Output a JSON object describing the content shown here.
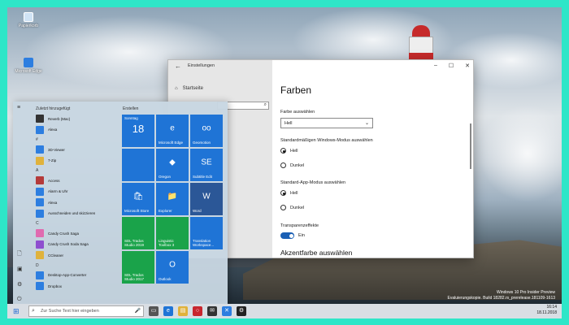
{
  "colors": {
    "accent": "#1a5fb4",
    "teal_frame": "#2ee6c8",
    "tile_blue": "#1f74d6",
    "tile_green": "#1aa34a",
    "tile_red": "#c8262e"
  },
  "desktop": {
    "icons": [
      {
        "label": "Papierkorb",
        "icon": "recycle-bin-icon"
      },
      {
        "label": "Microsoft Edge",
        "icon": "monitor-icon"
      }
    ]
  },
  "settings": {
    "title": "Einstellungen",
    "home": "Startseite",
    "page_title": "Farben",
    "color_label": "Farbe auswählen",
    "color_value": "Hell",
    "windows_mode_label": "Standardmäßigen Windows-Modus auswählen",
    "windows_mode_options": [
      {
        "label": "Hell",
        "selected": true
      },
      {
        "label": "Dunkel",
        "selected": false
      }
    ],
    "app_mode_label": "Standard-App-Modus auswählen",
    "app_mode_options": [
      {
        "label": "Hell",
        "selected": true
      },
      {
        "label": "Dunkel",
        "selected": false
      }
    ],
    "transparency_label": "Transparenzeffekte",
    "transparency_value": "Ein",
    "accent_heading": "Akzentfarbe auswählen"
  },
  "start": {
    "recent_heading": "Zuletzt hinzugefügt",
    "tiles_heading": "Erstellen",
    "apps": [
      {
        "label": "Reverb (Mac)",
        "color": "#333"
      },
      {
        "label": "Alexa",
        "color": "#2d7ee0"
      },
      {
        "letter": "#"
      },
      {
        "label": "3D-Viewer",
        "color": "#2d7ee0"
      },
      {
        "label": "7-Zip",
        "color": "#e0b23c"
      },
      {
        "letter": "A"
      },
      {
        "label": "Access",
        "color": "#b43a3a"
      },
      {
        "label": "Alarm & Uhr",
        "color": "#2d7ee0"
      },
      {
        "label": "Alexa",
        "color": "#2d7ee0"
      },
      {
        "label": "Ausschneiden und skizzieren",
        "color": "#2d7ee0"
      },
      {
        "letter": "C"
      },
      {
        "label": "Candy Crush Saga",
        "color": "#e06bb0"
      },
      {
        "label": "Candy Crush Soda Saga",
        "color": "#8e4fcf"
      },
      {
        "label": "CCleaner",
        "color": "#e0b23c"
      },
      {
        "letter": "D"
      },
      {
        "label": "Desktop-App-Converter",
        "color": "#2d7ee0"
      },
      {
        "label": "Dropbox",
        "color": "#2d7ee0"
      }
    ],
    "tiles": [
      {
        "label": "Sonntag",
        "big": "18",
        "color": "#1f74d6",
        "icon": ""
      },
      {
        "label": "Microsoft Edge",
        "color": "#1f74d6",
        "icon": "e"
      },
      {
        "label": "Geomotion",
        "color": "#1f74d6",
        "icon": "oo"
      },
      {
        "label": "",
        "color": "#1f74d6",
        "icon": ""
      },
      {
        "label": "Oregon",
        "color": "#1f74d6",
        "icon": "◆"
      },
      {
        "label": "Subtitle Edit",
        "color": "#1f74d6",
        "icon": "SE"
      },
      {
        "label": "Microsoft Store",
        "color": "#1f74d6",
        "icon": "🛍"
      },
      {
        "label": "Explorer",
        "color": "#1f74d6",
        "icon": "📁"
      },
      {
        "label": "Word",
        "color": "#2b5797",
        "icon": "W"
      },
      {
        "label": "SDL Trados Studio 2019",
        "color": "#1aa34a",
        "icon": ""
      },
      {
        "label": "Linguistic Toolbox 3",
        "color": "#1aa34a",
        "icon": ""
      },
      {
        "label": "Translation Workspace...",
        "color": "#1f74d6",
        "icon": ""
      },
      {
        "label": "SDL Trados Studio 2017",
        "color": "#1aa34a",
        "icon": ""
      },
      {
        "label": "Outlook",
        "color": "#1f74d6",
        "icon": "O"
      }
    ]
  },
  "taskbar": {
    "search_placeholder": "Zur Suche Text hier eingeben",
    "time": "16:14",
    "date": "18.11.2018"
  },
  "watermark": {
    "line1": "Windows 10 Pro Insider Preview",
    "line2": "Evaluierungskopie. Build 18282.rs_prerelease.181109-1613"
  }
}
